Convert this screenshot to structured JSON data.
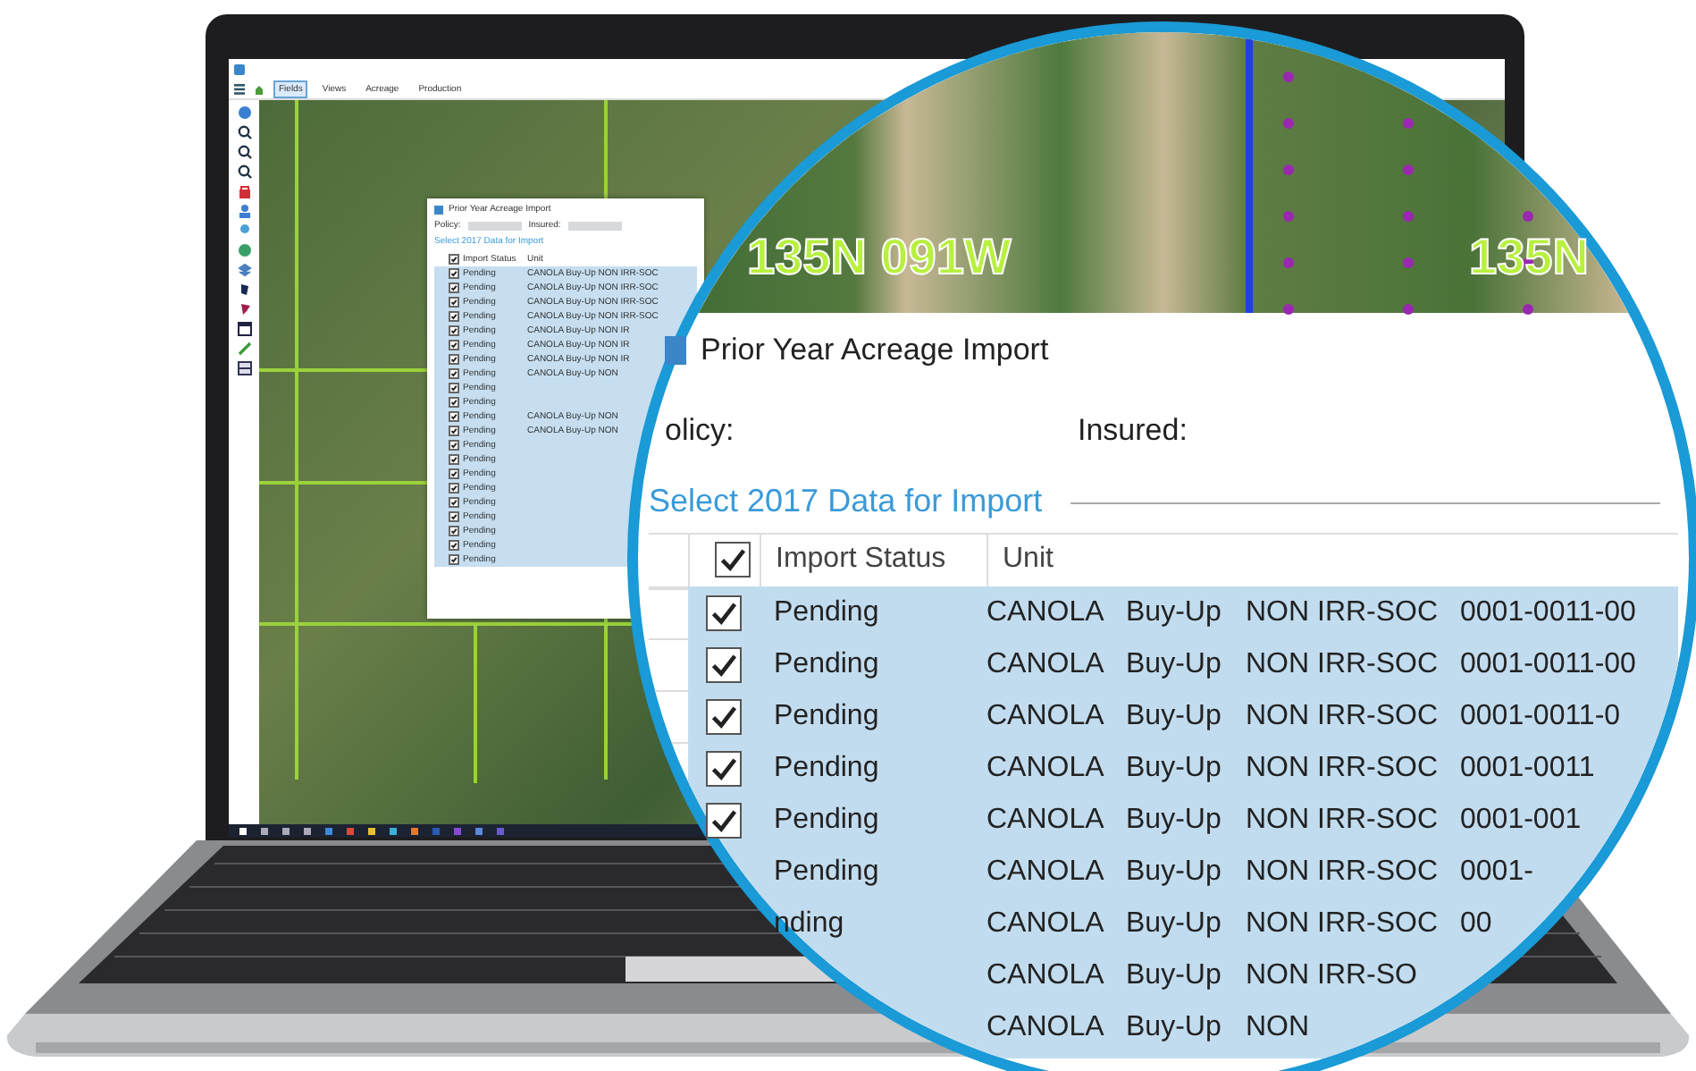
{
  "app": {
    "menu_tabs": [
      {
        "label": "Fields",
        "selected": true
      },
      {
        "label": "Views",
        "selected": false
      },
      {
        "label": "Acreage",
        "selected": false
      },
      {
        "label": "Production",
        "selected": false
      }
    ],
    "dialog": {
      "title": "Prior Year Acreage Import",
      "policy_label": "Policy:",
      "insured_label": "Insured:",
      "group_title": "Select 2017 Data for Import",
      "header_checked": true,
      "columns": [
        "Import Status",
        "Unit"
      ],
      "rows": [
        {
          "checked": true,
          "status": "Pending",
          "unit": "CANOLA Buy-Up NON IRR-SOC"
        },
        {
          "checked": true,
          "status": "Pending",
          "unit": "CANOLA Buy-Up NON IRR-SOC"
        },
        {
          "checked": true,
          "status": "Pending",
          "unit": "CANOLA Buy-Up NON IRR-SOC"
        },
        {
          "checked": true,
          "status": "Pending",
          "unit": "CANOLA Buy-Up NON IRR-SOC"
        },
        {
          "checked": true,
          "status": "Pending",
          "unit": "CANOLA Buy-Up NON IR"
        },
        {
          "checked": true,
          "status": "Pending",
          "unit": "CANOLA Buy-Up NON IR"
        },
        {
          "checked": true,
          "status": "Pending",
          "unit": "CANOLA Buy-Up NON IR"
        },
        {
          "checked": true,
          "status": "Pending",
          "unit": "CANOLA Buy-Up NON"
        },
        {
          "checked": true,
          "status": "Pending"
        },
        {
          "checked": true,
          "status": "Pending"
        },
        {
          "checked": true,
          "status": "Pending",
          "unit": "CANOLA Buy-Up NON"
        },
        {
          "checked": true,
          "status": "Pending",
          "unit": "CANOLA Buy-Up NON"
        },
        {
          "checked": true,
          "status": "Pending"
        },
        {
          "checked": true,
          "status": "Pending"
        },
        {
          "checked": true,
          "status": "Pending"
        },
        {
          "checked": true,
          "status": "Pending"
        },
        {
          "checked": true,
          "status": "Pending"
        },
        {
          "checked": true,
          "status": "Pending"
        },
        {
          "checked": true,
          "status": "Pending"
        },
        {
          "checked": true,
          "status": "Pending"
        },
        {
          "checked": true,
          "status": "Pending"
        }
      ]
    }
  },
  "magnifier": {
    "map_labels": [
      "135N 091W",
      "135N"
    ],
    "dialog": {
      "title": "Prior Year Acreage Import",
      "policy_label": "olicy:",
      "insured_label": "Insured:",
      "group_title": "Select 2017 Data for Import",
      "header_checked": true,
      "columns": [
        "Import Status",
        "Unit"
      ],
      "rows": [
        {
          "checked": true,
          "status": "Pending",
          "crop": "CANOLA",
          "coverage": "Buy-Up",
          "practice": "NON IRR-SOC",
          "unit": "0001-0011-00"
        },
        {
          "checked": true,
          "status": "Pending",
          "crop": "CANOLA",
          "coverage": "Buy-Up",
          "practice": "NON IRR-SOC",
          "unit": "0001-0011-00"
        },
        {
          "checked": true,
          "status": "Pending",
          "crop": "CANOLA",
          "coverage": "Buy-Up",
          "practice": "NON IRR-SOC",
          "unit": "0001-0011-0"
        },
        {
          "checked": true,
          "status": "Pending",
          "crop": "CANOLA",
          "coverage": "Buy-Up",
          "practice": "NON IRR-SOC",
          "unit": "0001-0011"
        },
        {
          "checked": true,
          "status": "Pending",
          "crop": "CANOLA",
          "coverage": "Buy-Up",
          "practice": "NON IRR-SOC",
          "unit": "0001-001"
        },
        {
          "status": "Pending",
          "crop": "CANOLA",
          "coverage": "Buy-Up",
          "practice": "NON IRR-SOC",
          "unit": "0001-"
        },
        {
          "status": "nding",
          "crop": "CANOLA",
          "coverage": "Buy-Up",
          "practice": "NON IRR-SOC",
          "unit": "00"
        },
        {
          "crop": "CANOLA",
          "coverage": "Buy-Up",
          "practice": "NON IRR-SO"
        },
        {
          "crop": "CANOLA",
          "coverage": "Buy-Up",
          "practice": "NON"
        }
      ]
    }
  }
}
